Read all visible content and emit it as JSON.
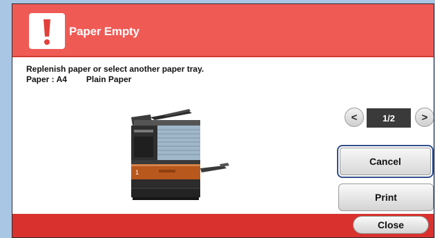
{
  "dialog": {
    "title": "Paper Empty",
    "alert_icon": "exclamation-icon",
    "message_line1": "Replenish paper or select another paper tray.",
    "paper_label": "Paper : A4",
    "paper_type": "Plain Paper",
    "tray_number": "1"
  },
  "pager": {
    "prev_icon": "chevron-left-icon",
    "next_icon": "chevron-right-icon",
    "prev_glyph": "<",
    "next_glyph": ">",
    "indicator": "1/2"
  },
  "actions": {
    "cancel_label": "Cancel",
    "print_label": "Print",
    "close_label": "Close"
  },
  "colors": {
    "title_bar": "#f05a55",
    "footer": "#d9322e",
    "background": "#a9c6e4",
    "focus_border": "#2f4e8a"
  }
}
